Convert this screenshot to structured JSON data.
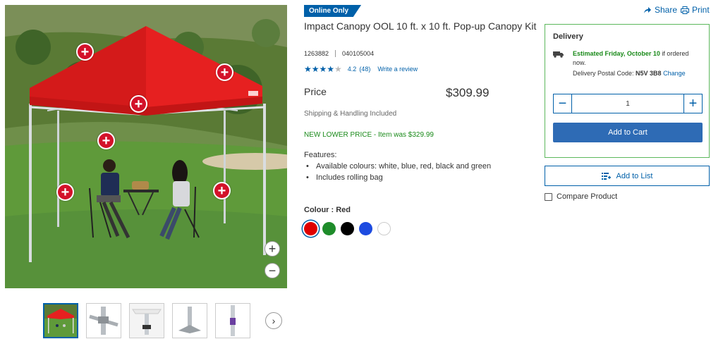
{
  "badge": "Online Only",
  "product": {
    "title": "Impact Canopy OOL 10 ft. x 10 ft. Pop-up Canopy Kit",
    "item_number": "1263882",
    "model_number": "040105004",
    "rating": {
      "stars": 4.2,
      "value": "4.2",
      "count": "(48)",
      "write_review": "Write a review"
    },
    "price_label": "Price",
    "price": "$309.99",
    "shipping": "Shipping & Handling Included",
    "promo": "NEW LOWER PRICE - Item was $329.99",
    "features_heading": "Features:",
    "features": [
      "Available colours: white, blue, red, black and green",
      "Includes rolling bag"
    ],
    "colour_label": "Colour : Red",
    "colours": [
      {
        "name": "red",
        "hex": "#e00000",
        "selected": true
      },
      {
        "name": "green",
        "hex": "#1e8c2a",
        "selected": false
      },
      {
        "name": "black",
        "hex": "#000000",
        "selected": false
      },
      {
        "name": "blue",
        "hex": "#1d4be0",
        "selected": false
      },
      {
        "name": "white",
        "hex": "#ffffff",
        "selected": false
      }
    ]
  },
  "gallery": {
    "hotspot_glyph": "+",
    "zoom_in": "+",
    "zoom_out": "−",
    "thumbnail_count": 5,
    "next_glyph": "›"
  },
  "actions": {
    "share": "Share",
    "print": "Print"
  },
  "delivery": {
    "title": "Delivery",
    "estimate_bold": "Estimated Friday, October 10",
    "estimate_rest": " if ordered now.",
    "postal_label": "Delivery Postal Code: ",
    "postal_code": "N5V 3B8",
    "change": "Change",
    "quantity": "1",
    "minus": "−",
    "plus": "+",
    "add_to_cart": "Add to Cart"
  },
  "add_to_list": "Add to List",
  "compare": "Compare Product",
  "colors": {
    "accent": "#0060a9",
    "cart_button": "#2e6bb5",
    "promo_green": "#1a8a1a",
    "delivery_border": "#5cb85c",
    "hotspot": "#d3122a"
  },
  "icons": {
    "share": "share-arrow-icon",
    "print": "printer-icon",
    "truck": "truck-icon",
    "list": "list-add-icon",
    "hotspot": "plus-circle-icon"
  }
}
